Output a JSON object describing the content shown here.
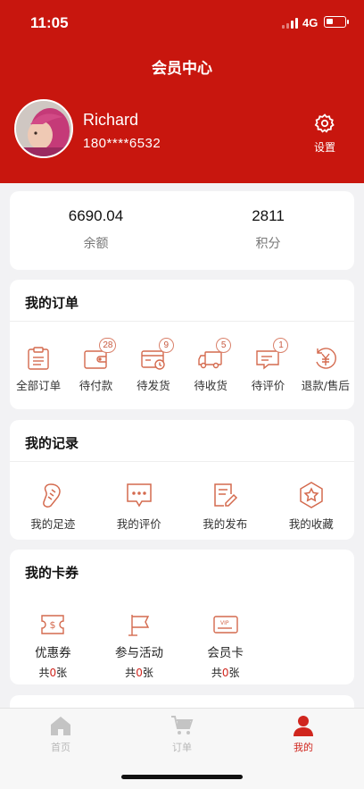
{
  "status": {
    "time": "11:05",
    "network": "4G"
  },
  "header": {
    "title": "会员中心",
    "username": "Richard",
    "phone": "180****6532",
    "settings_label": "设置"
  },
  "stats": [
    {
      "value": "6690.04",
      "label": "余额"
    },
    {
      "value": "2811",
      "label": "积分"
    }
  ],
  "orders": {
    "title": "我的订单",
    "items": [
      {
        "label": "全部订单",
        "icon": "clipboard-icon"
      },
      {
        "label": "待付款",
        "icon": "wallet-icon",
        "badge": "28"
      },
      {
        "label": "待发货",
        "icon": "calendar-clock-icon",
        "badge": "9"
      },
      {
        "label": "待收货",
        "icon": "truck-icon",
        "badge": "5"
      },
      {
        "label": "待评价",
        "icon": "comment-icon",
        "badge": "1"
      },
      {
        "label": "退款/售后",
        "icon": "yen-refund-icon"
      }
    ]
  },
  "records": {
    "title": "我的记录",
    "items": [
      {
        "label": "我的足迹",
        "icon": "footprint-icon"
      },
      {
        "label": "我的评价",
        "icon": "chat-bubble-icon"
      },
      {
        "label": "我的发布",
        "icon": "edit-document-icon"
      },
      {
        "label": "我的收藏",
        "icon": "star-hexagon-icon"
      }
    ]
  },
  "coupons": {
    "title": "我的卡券",
    "items": [
      {
        "label": "优惠券",
        "icon": "coupon-icon",
        "prefix": "共",
        "count": "0",
        "suffix": "张"
      },
      {
        "label": "参与活动",
        "icon": "flag-icon",
        "prefix": "共",
        "count": "0",
        "suffix": "张"
      },
      {
        "label": "会员卡",
        "icon": "vip-card-icon",
        "prefix": "共",
        "count": "0",
        "suffix": "张"
      }
    ]
  },
  "tabbar": {
    "items": [
      {
        "label": "首页",
        "icon": "home-icon",
        "active": false
      },
      {
        "label": "订单",
        "icon": "cart-icon",
        "active": false
      },
      {
        "label": "我的",
        "icon": "user-icon",
        "active": true
      }
    ]
  },
  "colors": {
    "brand": "#c8160e",
    "icon_accent": "#d46a4e",
    "active": "#d0261e",
    "inactive": "#b8b8b8"
  }
}
